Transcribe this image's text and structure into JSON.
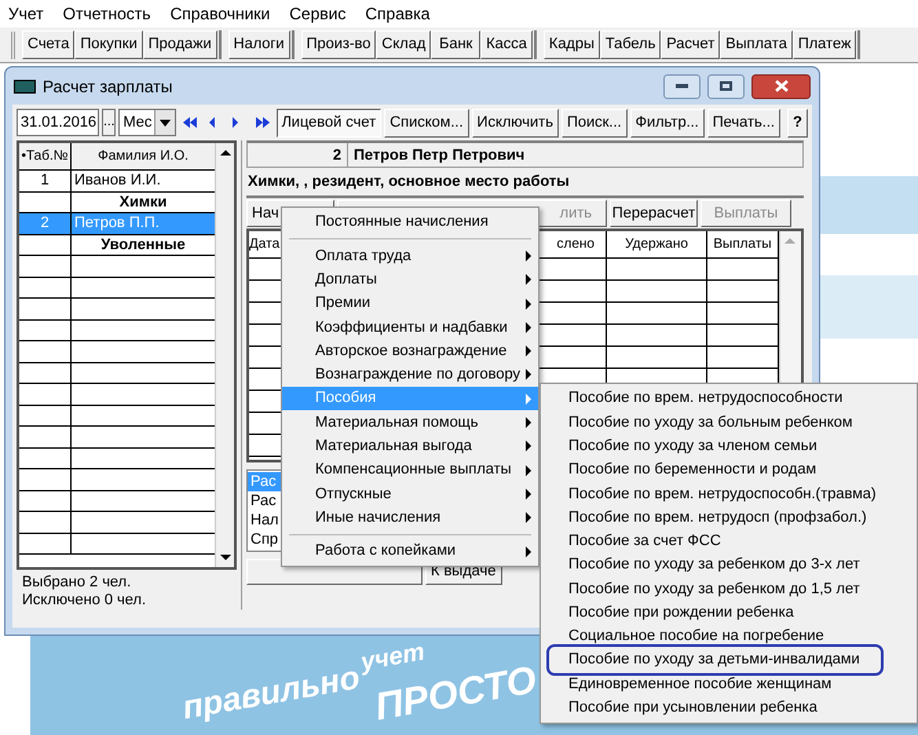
{
  "menu_bar": [
    "Учет",
    "Отчетность",
    "Справочники",
    "Сервис",
    "Справка"
  ],
  "toolbar_groups": [
    [
      "Счета",
      "Покупки",
      "Продажи"
    ],
    [
      "Налоги"
    ],
    [
      "Произ-во",
      "Склад",
      "Банк",
      "Касса"
    ],
    [
      "Кадры",
      "Табель",
      "Расчет",
      "Выплата",
      "Платеж"
    ]
  ],
  "desktop_slogan": [
    "учет",
    "правильно",
    "ПРОСТО"
  ],
  "window": {
    "title": "Расчет зарплаты",
    "date": "31.01.2016",
    "date_button": "...",
    "period": "Мес",
    "tool_buttons": [
      {
        "label": "Лицевой счет",
        "selected": true
      },
      {
        "label": "Списком...",
        "selected": false
      },
      {
        "label": "Исключить",
        "selected": false
      },
      {
        "label": "Поиск...",
        "selected": false
      },
      {
        "label": "Фильтр...",
        "selected": false
      },
      {
        "label": "Печать...",
        "selected": false
      },
      {
        "label": "?",
        "selected": false
      }
    ],
    "employees": {
      "columns": [
        "•Таб.№",
        "Фамилия И.О."
      ],
      "rows": [
        {
          "kind": "employee",
          "number": "1",
          "name": "Иванов И.И.",
          "selected": false
        },
        {
          "kind": "group",
          "name": "Химки"
        },
        {
          "kind": "employee",
          "number": "2",
          "name": "Петров П.П.",
          "selected": true
        },
        {
          "kind": "group",
          "name": "Уволенные"
        }
      ]
    },
    "status": [
      "Выбрано 2 чел.",
      "Исключено 0 чел."
    ],
    "account": {
      "number": "2",
      "name": "Петров Петр Петрович",
      "info": "Химки, , резидент, основное место работы",
      "tabs": [
        {
          "label": "Нач",
          "disabled": false
        },
        {
          "label": "лить",
          "disabled": true
        },
        {
          "label": "Перерасчет",
          "disabled": false
        },
        {
          "label": "Выплаты",
          "disabled": true
        }
      ],
      "columns": [
        "Дата",
        "слено",
        "Удержано",
        "Выплаты"
      ],
      "list": [
        {
          "label": "Рас",
          "selected": true
        },
        {
          "label": "Рас",
          "selected": false
        },
        {
          "label": "Нал",
          "selected": false
        },
        {
          "label": "Спр",
          "selected": false
        }
      ],
      "bottom_buttons": [
        "К выдаче"
      ]
    }
  },
  "context_menu": [
    {
      "kind": "item",
      "label": "Постоянные начисления",
      "submenu": false,
      "selected": false
    },
    {
      "kind": "separator"
    },
    {
      "kind": "item",
      "label": "Оплата труда",
      "submenu": true,
      "selected": false
    },
    {
      "kind": "item",
      "label": "Доплаты",
      "submenu": true,
      "selected": false
    },
    {
      "kind": "item",
      "label": "Премии",
      "submenu": true,
      "selected": false
    },
    {
      "kind": "item",
      "label": "Коэффициенты и надбавки",
      "submenu": true,
      "selected": false
    },
    {
      "kind": "item",
      "label": "Авторское вознаграждение",
      "submenu": true,
      "selected": false
    },
    {
      "kind": "item",
      "label": "Вознаграждение по договору",
      "submenu": true,
      "selected": false
    },
    {
      "kind": "item",
      "label": "Пособия",
      "submenu": true,
      "selected": true
    },
    {
      "kind": "item",
      "label": "Материальная помощь",
      "submenu": true,
      "selected": false
    },
    {
      "kind": "item",
      "label": "Материальная выгода",
      "submenu": true,
      "selected": false
    },
    {
      "kind": "item",
      "label": "Компенсационные выплаты",
      "submenu": true,
      "selected": false
    },
    {
      "kind": "item",
      "label": "Отпускные",
      "submenu": true,
      "selected": false
    },
    {
      "kind": "item",
      "label": "Иные начисления",
      "submenu": true,
      "selected": false
    },
    {
      "kind": "separator"
    },
    {
      "kind": "item",
      "label": "Работа с копейками",
      "submenu": true,
      "selected": false
    }
  ],
  "submenu": [
    {
      "label": "Пособие по врем. нетрудоспособности",
      "circled": false
    },
    {
      "label": "Пособие по уходу за больным ребенком",
      "circled": false
    },
    {
      "label": "Пособие по уходу за членом семьи",
      "circled": false
    },
    {
      "label": "Пособие по беременности и родам",
      "circled": false
    },
    {
      "label": "Пособие по врем. нетрудоспособн.(травма)",
      "circled": false
    },
    {
      "label": "Пособие по врем. нетрудосп (профзабол.)",
      "circled": false
    },
    {
      "label": "Пособие за счет ФСС",
      "circled": false
    },
    {
      "label": "Пособие по уходу за ребенком до 3-х лет",
      "circled": false
    },
    {
      "label": "Пособие по уходу за ребенком до 1,5 лет",
      "circled": false
    },
    {
      "label": "Пособие при рождении ребенка",
      "circled": false
    },
    {
      "label": "Социальное пособие на погребение",
      "circled": false
    },
    {
      "label": "Пособие по уходу за детьми-инвалидами",
      "circled": true
    },
    {
      "label": "Единовременное пособие женщинам",
      "circled": false
    },
    {
      "label": "Пособие при усыновлении ребенка",
      "circled": false
    }
  ]
}
